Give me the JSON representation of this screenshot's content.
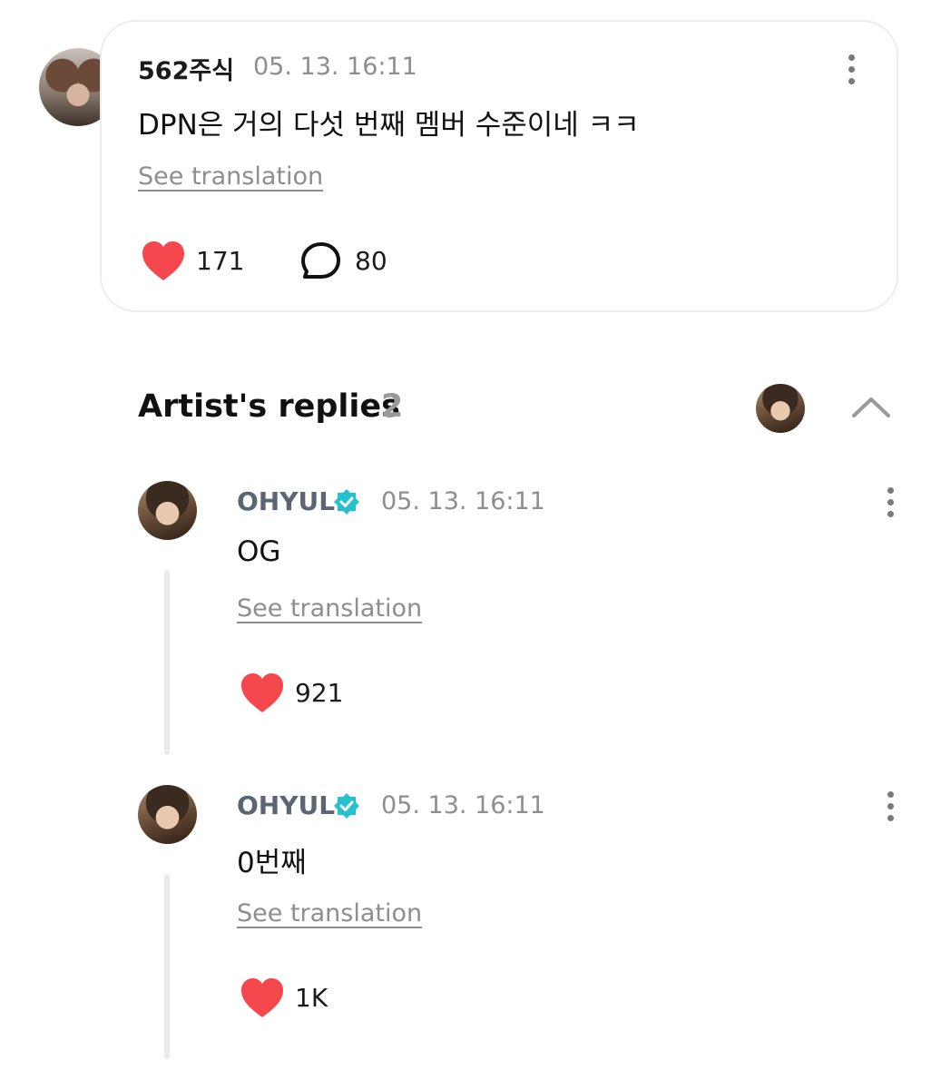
{
  "comment": {
    "username": "562주식",
    "timestamp": "05. 13. 16:11",
    "text": "DPN은 거의 다섯 번째 멤버 수준이네 ㅋㅋ",
    "see_translation": "See translation",
    "likes": "171",
    "replies": "80"
  },
  "artist_replies": {
    "title": "Artist's replies",
    "count": "2",
    "items": [
      {
        "name": "OHYUL",
        "timestamp": "05. 13. 16:11",
        "text": "OG",
        "see_translation": "See translation",
        "likes": "921"
      },
      {
        "name": "OHYUL",
        "timestamp": "05. 13. 16:11",
        "text": "0번째",
        "see_translation": "See translation",
        "likes": "1K"
      }
    ]
  },
  "colors": {
    "heart": "#f4474e",
    "verified": "#27c0cf",
    "artist_name": "#5b6675"
  },
  "icons": [
    "more-vertical-icon",
    "heart-icon",
    "comment-bubble-icon",
    "verified-badge-icon",
    "chevron-up-icon"
  ]
}
